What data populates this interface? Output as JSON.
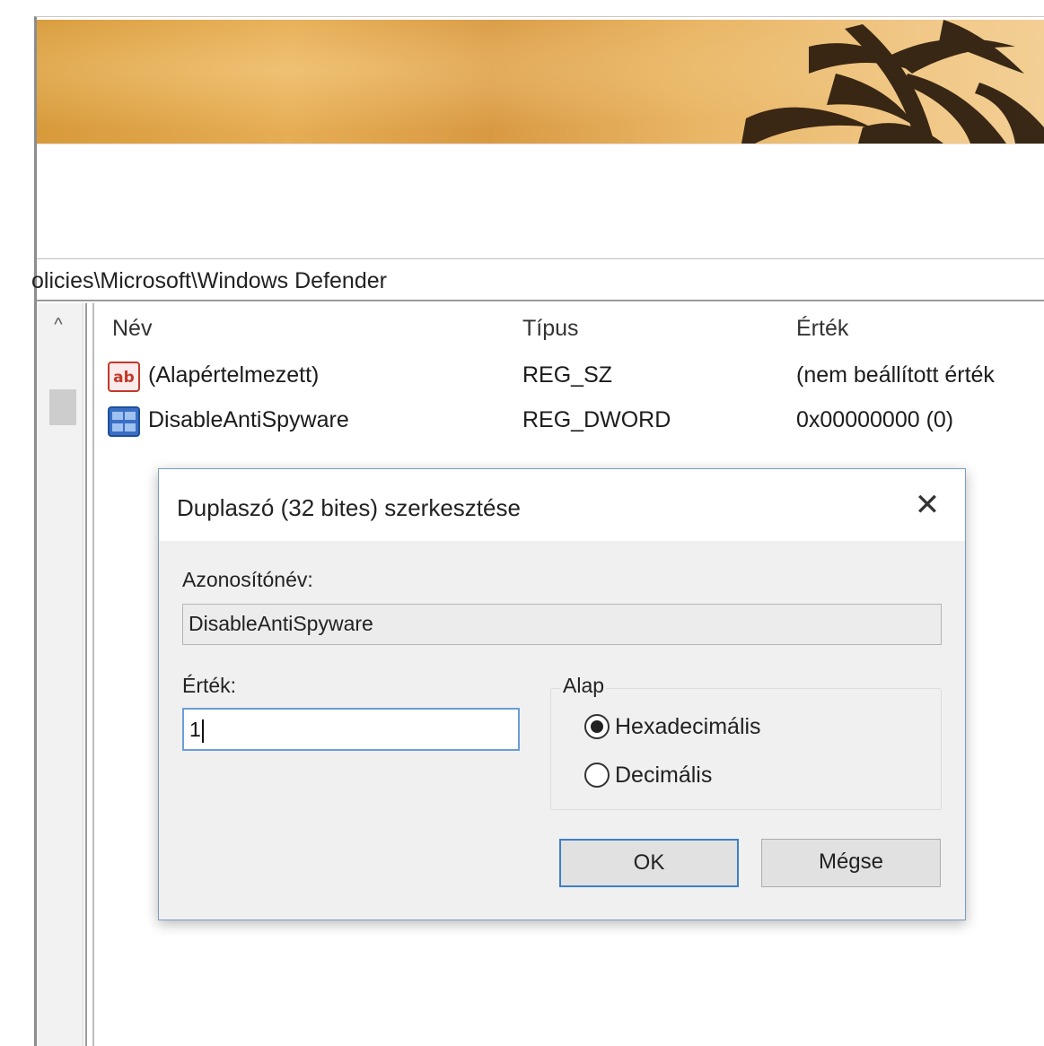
{
  "address": {
    "path": "olicies\\Microsoft\\Windows Defender"
  },
  "list": {
    "headers": {
      "name": "Név",
      "type": "Típus",
      "value": "Érték"
    },
    "rows": [
      {
        "name": "(Alapértelmezett)",
        "type": "REG_SZ",
        "value": "(nem beállított érték",
        "icon": "string-value-icon"
      },
      {
        "name": "DisableAntiSpyware",
        "type": "REG_DWORD",
        "value": "0x00000000 (0)",
        "icon": "dword-value-icon"
      }
    ]
  },
  "dialog": {
    "title": "Duplaszó (32 bites) szerkesztése",
    "close_glyph": "✕",
    "name_label": "Azonosítónév:",
    "name_value": "DisableAntiSpyware",
    "value_label": "Érték:",
    "value_input": "1",
    "base_label": "Alap",
    "base_options": [
      {
        "label": "Hexadecimális",
        "selected": true
      },
      {
        "label": "Decimális",
        "selected": false
      }
    ],
    "ok_label": "OK",
    "cancel_label": "Mégse"
  },
  "tree": {
    "scroll_up_glyph": "^"
  },
  "colors": {
    "banner": "#d99943",
    "accent": "#3c7fc9",
    "dialog_bg": "#f0f0f0"
  }
}
